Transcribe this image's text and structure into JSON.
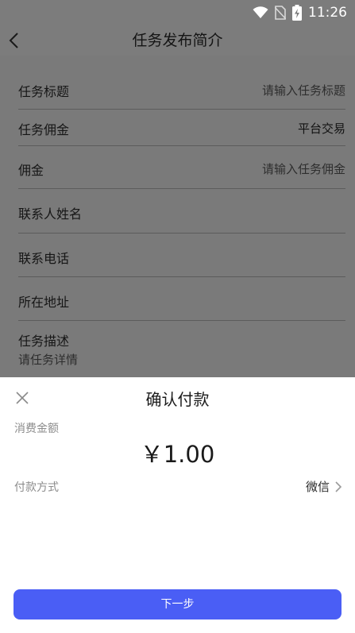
{
  "status_bar": {
    "time": "11:26",
    "icons": [
      "wifi-icon",
      "no-sim-icon",
      "battery-charging-icon"
    ]
  },
  "header": {
    "title": "任务发布简介",
    "back_icon": "chevron-left-icon"
  },
  "form": {
    "task_title": {
      "label": "任务标题",
      "placeholder": "请输入任务标题"
    },
    "task_commission": {
      "label": "任务佣金",
      "value": "平台交易"
    },
    "commission": {
      "label": "佣金",
      "placeholder": "请输入任务佣金"
    },
    "contact_name": {
      "label": "联系人姓名"
    },
    "contact_phone": {
      "label": "联系电话"
    },
    "address": {
      "label": "所在地址"
    },
    "description": {
      "label": "任务描述",
      "placeholder": "请任务详情"
    }
  },
  "payment_sheet": {
    "title": "确认付款",
    "amount_label": "消费金额",
    "amount": "￥1.00",
    "method_label": "付款方式",
    "method_value": "微信",
    "next_button": "下一步",
    "button_color": "#4a5ef5"
  }
}
